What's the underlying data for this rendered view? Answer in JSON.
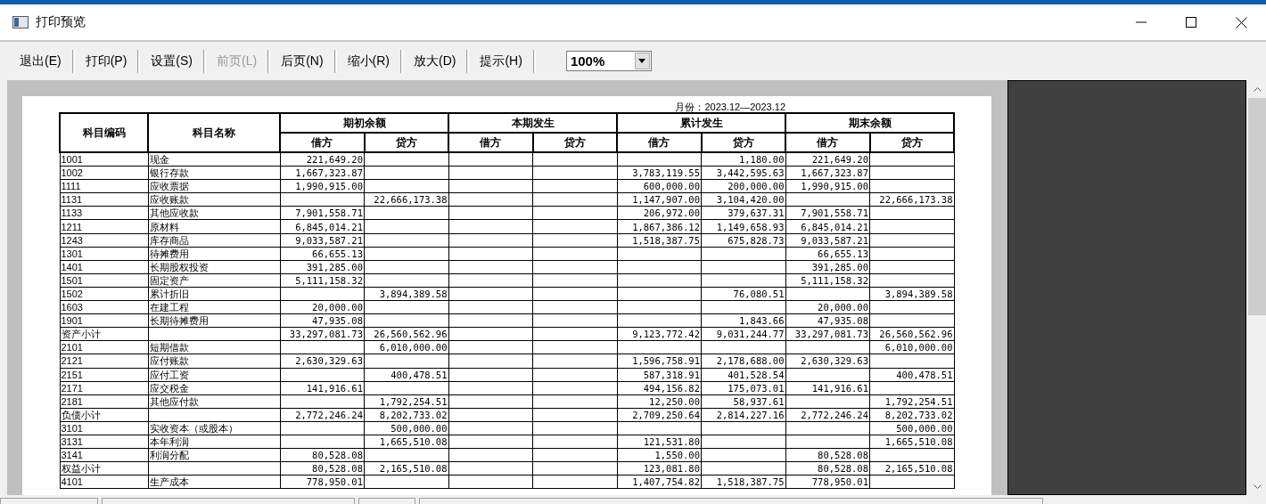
{
  "window": {
    "title": "打印预览"
  },
  "toolbar": {
    "buttons": [
      {
        "label": "退出(E)",
        "disabled": false
      },
      {
        "label": "打印(P)",
        "disabled": false
      },
      {
        "label": "设置(S)",
        "disabled": false
      },
      {
        "label": "前页(L)",
        "disabled": true
      },
      {
        "label": "后页(N)",
        "disabled": false
      },
      {
        "label": "缩小(R)",
        "disabled": false
      },
      {
        "label": "放大(D)",
        "disabled": false
      },
      {
        "label": "提示(H)",
        "disabled": false
      }
    ],
    "zoom": {
      "value": "100%"
    }
  },
  "report": {
    "period": "月份：2023.12—2023.12",
    "columns": [
      {
        "label": "科目编码"
      },
      {
        "label": "科目名称"
      },
      {
        "label": "期初余额",
        "sub": [
          "借方",
          "贷方"
        ]
      },
      {
        "label": "本期发生",
        "sub": [
          "借方",
          "贷方"
        ]
      },
      {
        "label": "累计发生",
        "sub": [
          "借方",
          "贷方"
        ]
      },
      {
        "label": "期末余额",
        "sub": [
          "借方",
          "贷方"
        ]
      }
    ],
    "rows": [
      {
        "code": "1001",
        "name": "现金",
        "opening_debit": "221,649.20",
        "cumulative_credit": "1,180.00",
        "closing_debit": "221,649.20"
      },
      {
        "code": "1002",
        "name": "银行存款",
        "opening_debit": "1,667,323.87",
        "cumulative_debit": "3,783,119.55",
        "cumulative_credit": "3,442,595.63",
        "closing_debit": "1,667,323.87"
      },
      {
        "code": "1111",
        "name": "应收票据",
        "opening_debit": "1,990,915.00",
        "cumulative_debit": "600,000.00",
        "cumulative_credit": "200,000.00",
        "closing_debit": "1,990,915.00"
      },
      {
        "code": "1131",
        "name": "应收账款",
        "opening_credit": "22,666,173.38",
        "cumulative_debit": "1,147,907.00",
        "cumulative_credit": "3,104,420.00",
        "closing_credit": "22,666,173.38"
      },
      {
        "code": "1133",
        "name": "其他应收款",
        "opening_debit": "7,901,558.71",
        "cumulative_debit": "206,972.00",
        "cumulative_credit": "379,637.31",
        "closing_debit": "7,901,558.71"
      },
      {
        "code": "1211",
        "name": "原材料",
        "opening_debit": "6,845,014.21",
        "cumulative_debit": "1,867,386.12",
        "cumulative_credit": "1,149,658.93",
        "closing_debit": "6,845,014.21"
      },
      {
        "code": "1243",
        "name": "库存商品",
        "opening_debit": "9,033,587.21",
        "cumulative_debit": "1,518,387.75",
        "cumulative_credit": "675,828.73",
        "closing_debit": "9,033,587.21"
      },
      {
        "code": "1301",
        "name": "待摊费用",
        "opening_debit": "66,655.13",
        "closing_debit": "66,655.13"
      },
      {
        "code": "1401",
        "name": "长期股权投资",
        "opening_debit": "391,285.00",
        "closing_debit": "391,285.00"
      },
      {
        "code": "1501",
        "name": "固定资产",
        "opening_debit": "5,111,158.32",
        "closing_debit": "5,111,158.32"
      },
      {
        "code": "1502",
        "name": "累计折旧",
        "opening_credit": "3,894,389.58",
        "cumulative_credit": "76,080.51",
        "closing_credit": "3,894,389.58"
      },
      {
        "code": "1603",
        "name": "在建工程",
        "opening_debit": "20,000.00",
        "closing_debit": "20,000.00"
      },
      {
        "code": "1901",
        "name": "长期待摊费用",
        "opening_debit": "47,935.08",
        "cumulative_credit": "1,843.66",
        "closing_debit": "47,935.08"
      },
      {
        "code": "资产小计",
        "opening_debit": "33,297,081.73",
        "opening_credit": "26,560,562.96",
        "cumulative_debit": "9,123,772.42",
        "cumulative_credit": "9,031,244.77",
        "closing_debit": "33,297,081.73",
        "closing_credit": "26,560,562.96"
      },
      {
        "code": "2101",
        "name": "短期借款",
        "opening_credit": "6,010,000.00",
        "closing_credit": "6,010,000.00"
      },
      {
        "code": "2121",
        "name": "应付账款",
        "opening_debit": "2,630,329.63",
        "cumulative_debit": "1,596,758.91",
        "cumulative_credit": "2,178,688.00",
        "closing_debit": "2,630,329.63"
      },
      {
        "code": "2151",
        "name": "应付工资",
        "opening_credit": "400,478.51",
        "cumulative_debit": "587,318.91",
        "cumulative_credit": "401,528.54",
        "closing_credit": "400,478.51"
      },
      {
        "code": "2171",
        "name": "应交税金",
        "opening_debit": "141,916.61",
        "cumulative_debit": "494,156.82",
        "cumulative_credit": "175,073.01",
        "closing_debit": "141,916.61"
      },
      {
        "code": "2181",
        "name": "其他应付款",
        "opening_credit": "1,792,254.51",
        "cumulative_debit": "12,250.00",
        "cumulative_credit": "58,937.61",
        "closing_credit": "1,792,254.51"
      },
      {
        "code": "负债小计",
        "opening_debit": "2,772,246.24",
        "opening_credit": "8,202,733.02",
        "cumulative_debit": "2,709,250.64",
        "cumulative_credit": "2,814,227.16",
        "closing_debit": "2,772,246.24",
        "closing_credit": "8,202,733.02"
      },
      {
        "code": "3101",
        "name": "实收资本（或股本）",
        "opening_credit": "500,000.00",
        "closing_credit": "500,000.00"
      },
      {
        "code": "3131",
        "name": "本年利润",
        "opening_credit": "1,665,510.08",
        "cumulative_debit": "121,531.80",
        "closing_credit": "1,665,510.08"
      },
      {
        "code": "3141",
        "name": "利润分配",
        "opening_debit": "80,528.08",
        "cumulative_debit": "1,550.00",
        "closing_debit": "80,528.08"
      },
      {
        "code": "权益小计",
        "opening_debit": "80,528.08",
        "opening_credit": "2,165,510.08",
        "cumulative_debit": "123,081.80",
        "closing_debit": "80,528.08",
        "closing_credit": "2,165,510.08"
      },
      {
        "code": "4101",
        "name": "生产成本",
        "opening_debit": "778,950.01",
        "cumulative_debit": "1,407,754.82",
        "cumulative_credit": "1,518,387.75",
        "closing_debit": "778,950.01"
      }
    ]
  }
}
